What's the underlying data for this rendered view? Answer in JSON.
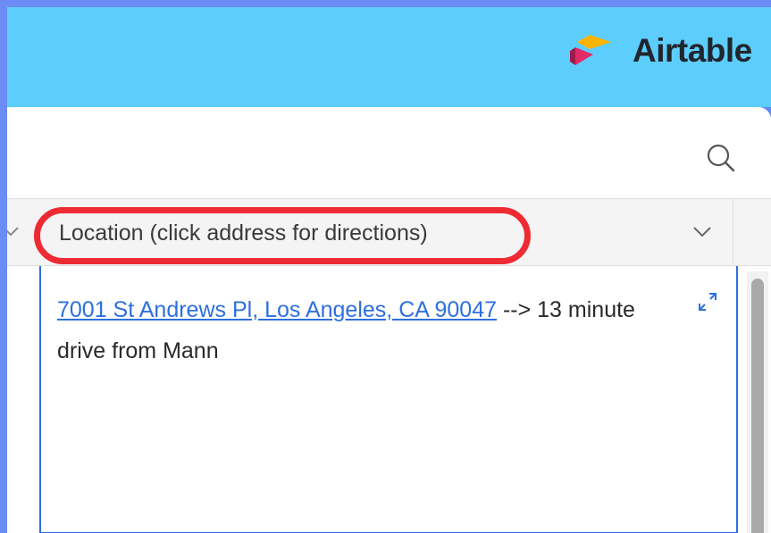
{
  "app": {
    "logo_text": "Airtable"
  },
  "field": {
    "header_label": "Location (click address for directions)",
    "cell_link": "7001 St Andrews Pl, Los Angeles, CA 90047",
    "cell_text": " --> 13 minute drive from Mann"
  },
  "icons": {
    "search": "search-icon",
    "expand": "expand-icon",
    "chevron": "chevron-down-icon"
  },
  "colors": {
    "topbar": "#5dcdfd",
    "frame": "#6c8bf5",
    "highlight": "#ee2a33",
    "link": "#2d6fe0"
  }
}
